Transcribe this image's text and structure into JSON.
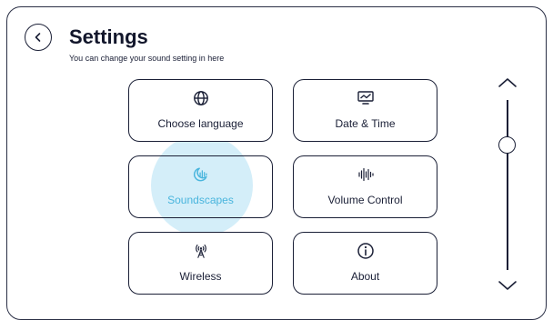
{
  "header": {
    "title": "Settings",
    "subtitle": "You can change your sound setting in here"
  },
  "tiles": [
    {
      "label": "Choose language",
      "icon": "globe-icon"
    },
    {
      "label": "Date & Time",
      "icon": "monitor-chart-icon"
    },
    {
      "label": "Soundscapes",
      "icon": "soundscape-moon-icon",
      "active": true
    },
    {
      "label": "Volume Control",
      "icon": "sound-wave-icon"
    },
    {
      "label": "Wireless",
      "icon": "wireless-tower-icon"
    },
    {
      "label": "About",
      "icon": "info-icon"
    }
  ],
  "colors": {
    "foreground": "#1a1f36",
    "accent": "#49b5dd",
    "highlight": "#d4eef9"
  },
  "scrollbar": {
    "position": 0.24
  }
}
